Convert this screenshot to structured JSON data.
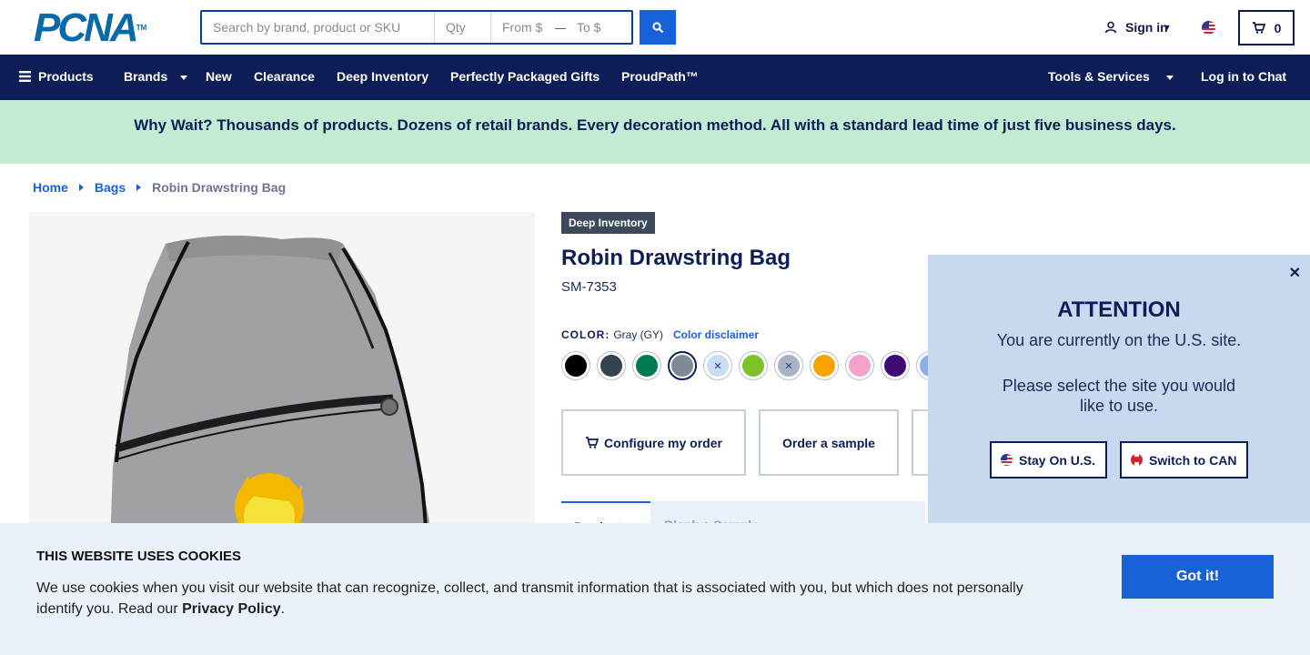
{
  "header": {
    "logo_text": "PCNA",
    "logo_tm": "TM",
    "search_placeholder": "Search by brand, product or SKU",
    "qty_placeholder": "Qty",
    "from_placeholder": "From $",
    "to_placeholder": "To $",
    "dash": "—",
    "signin_label": "Sign in",
    "cart_count": "0"
  },
  "nav": {
    "products": "Products",
    "brands": "Brands",
    "new": "New",
    "clearance": "Clearance",
    "deep_inventory": "Deep Inventory",
    "gifts": "Perfectly Packaged Gifts",
    "proudpath": "ProudPath™",
    "tools": "Tools & Services",
    "chat": "Log in to Chat"
  },
  "banner": {
    "text": "Why Wait? Thousands of products. Dozens of retail brands. Every decoration method. All with a standard lead time of just five business days."
  },
  "breadcrumb": {
    "home": "Home",
    "bags": "Bags",
    "current": "Robin Drawstring Bag"
  },
  "product": {
    "tag": "Deep Inventory",
    "title": "Robin Drawstring Bag",
    "sku": "SM-7353",
    "color_label": "COLOR:",
    "color_value": "Gray (GY)",
    "color_disclaimer": "Color disclaimer",
    "swatches": [
      {
        "name": "black",
        "color": "#000000",
        "crossed": false
      },
      {
        "name": "charcoal",
        "color": "#36424c",
        "crossed": false
      },
      {
        "name": "green",
        "color": "#007a4f",
        "crossed": false
      },
      {
        "name": "gray",
        "color": "#7f8a92",
        "crossed": false,
        "selected": true
      },
      {
        "name": "light-blue",
        "color": "#c9def3",
        "crossed": true
      },
      {
        "name": "lime",
        "color": "#7ec128",
        "crossed": false
      },
      {
        "name": "silver",
        "color": "#aab3c3",
        "crossed": true
      },
      {
        "name": "orange",
        "color": "#f7a400",
        "crossed": false
      },
      {
        "name": "pink",
        "color": "#f5a1cc",
        "crossed": false
      },
      {
        "name": "purple",
        "color": "#3d0a78",
        "crossed": false
      },
      {
        "name": "royal",
        "color": "#8ab0e6",
        "crossed": true
      }
    ],
    "configure_label": "Configure my order",
    "sample_label": "Order a sample",
    "tab_details": "Product",
    "tab_samples": "Blank + Sample"
  },
  "attention": {
    "title": "ATTENTION",
    "line1": "You are currently on the U.S. site.",
    "line2": "Please select the site you would like to use.",
    "stay_label": "Stay On U.S.",
    "switch_label": "Switch to CAN",
    "close": "✕"
  },
  "cookie": {
    "title": "THIS WEBSITE USES COOKIES",
    "text": "We use cookies when you visit our website that can recognize, collect, and transmit information that is associated with you, but which does not personally identify you. Read our ",
    "policy_link": "Privacy Policy",
    "period": ".",
    "button": "Got it!"
  }
}
